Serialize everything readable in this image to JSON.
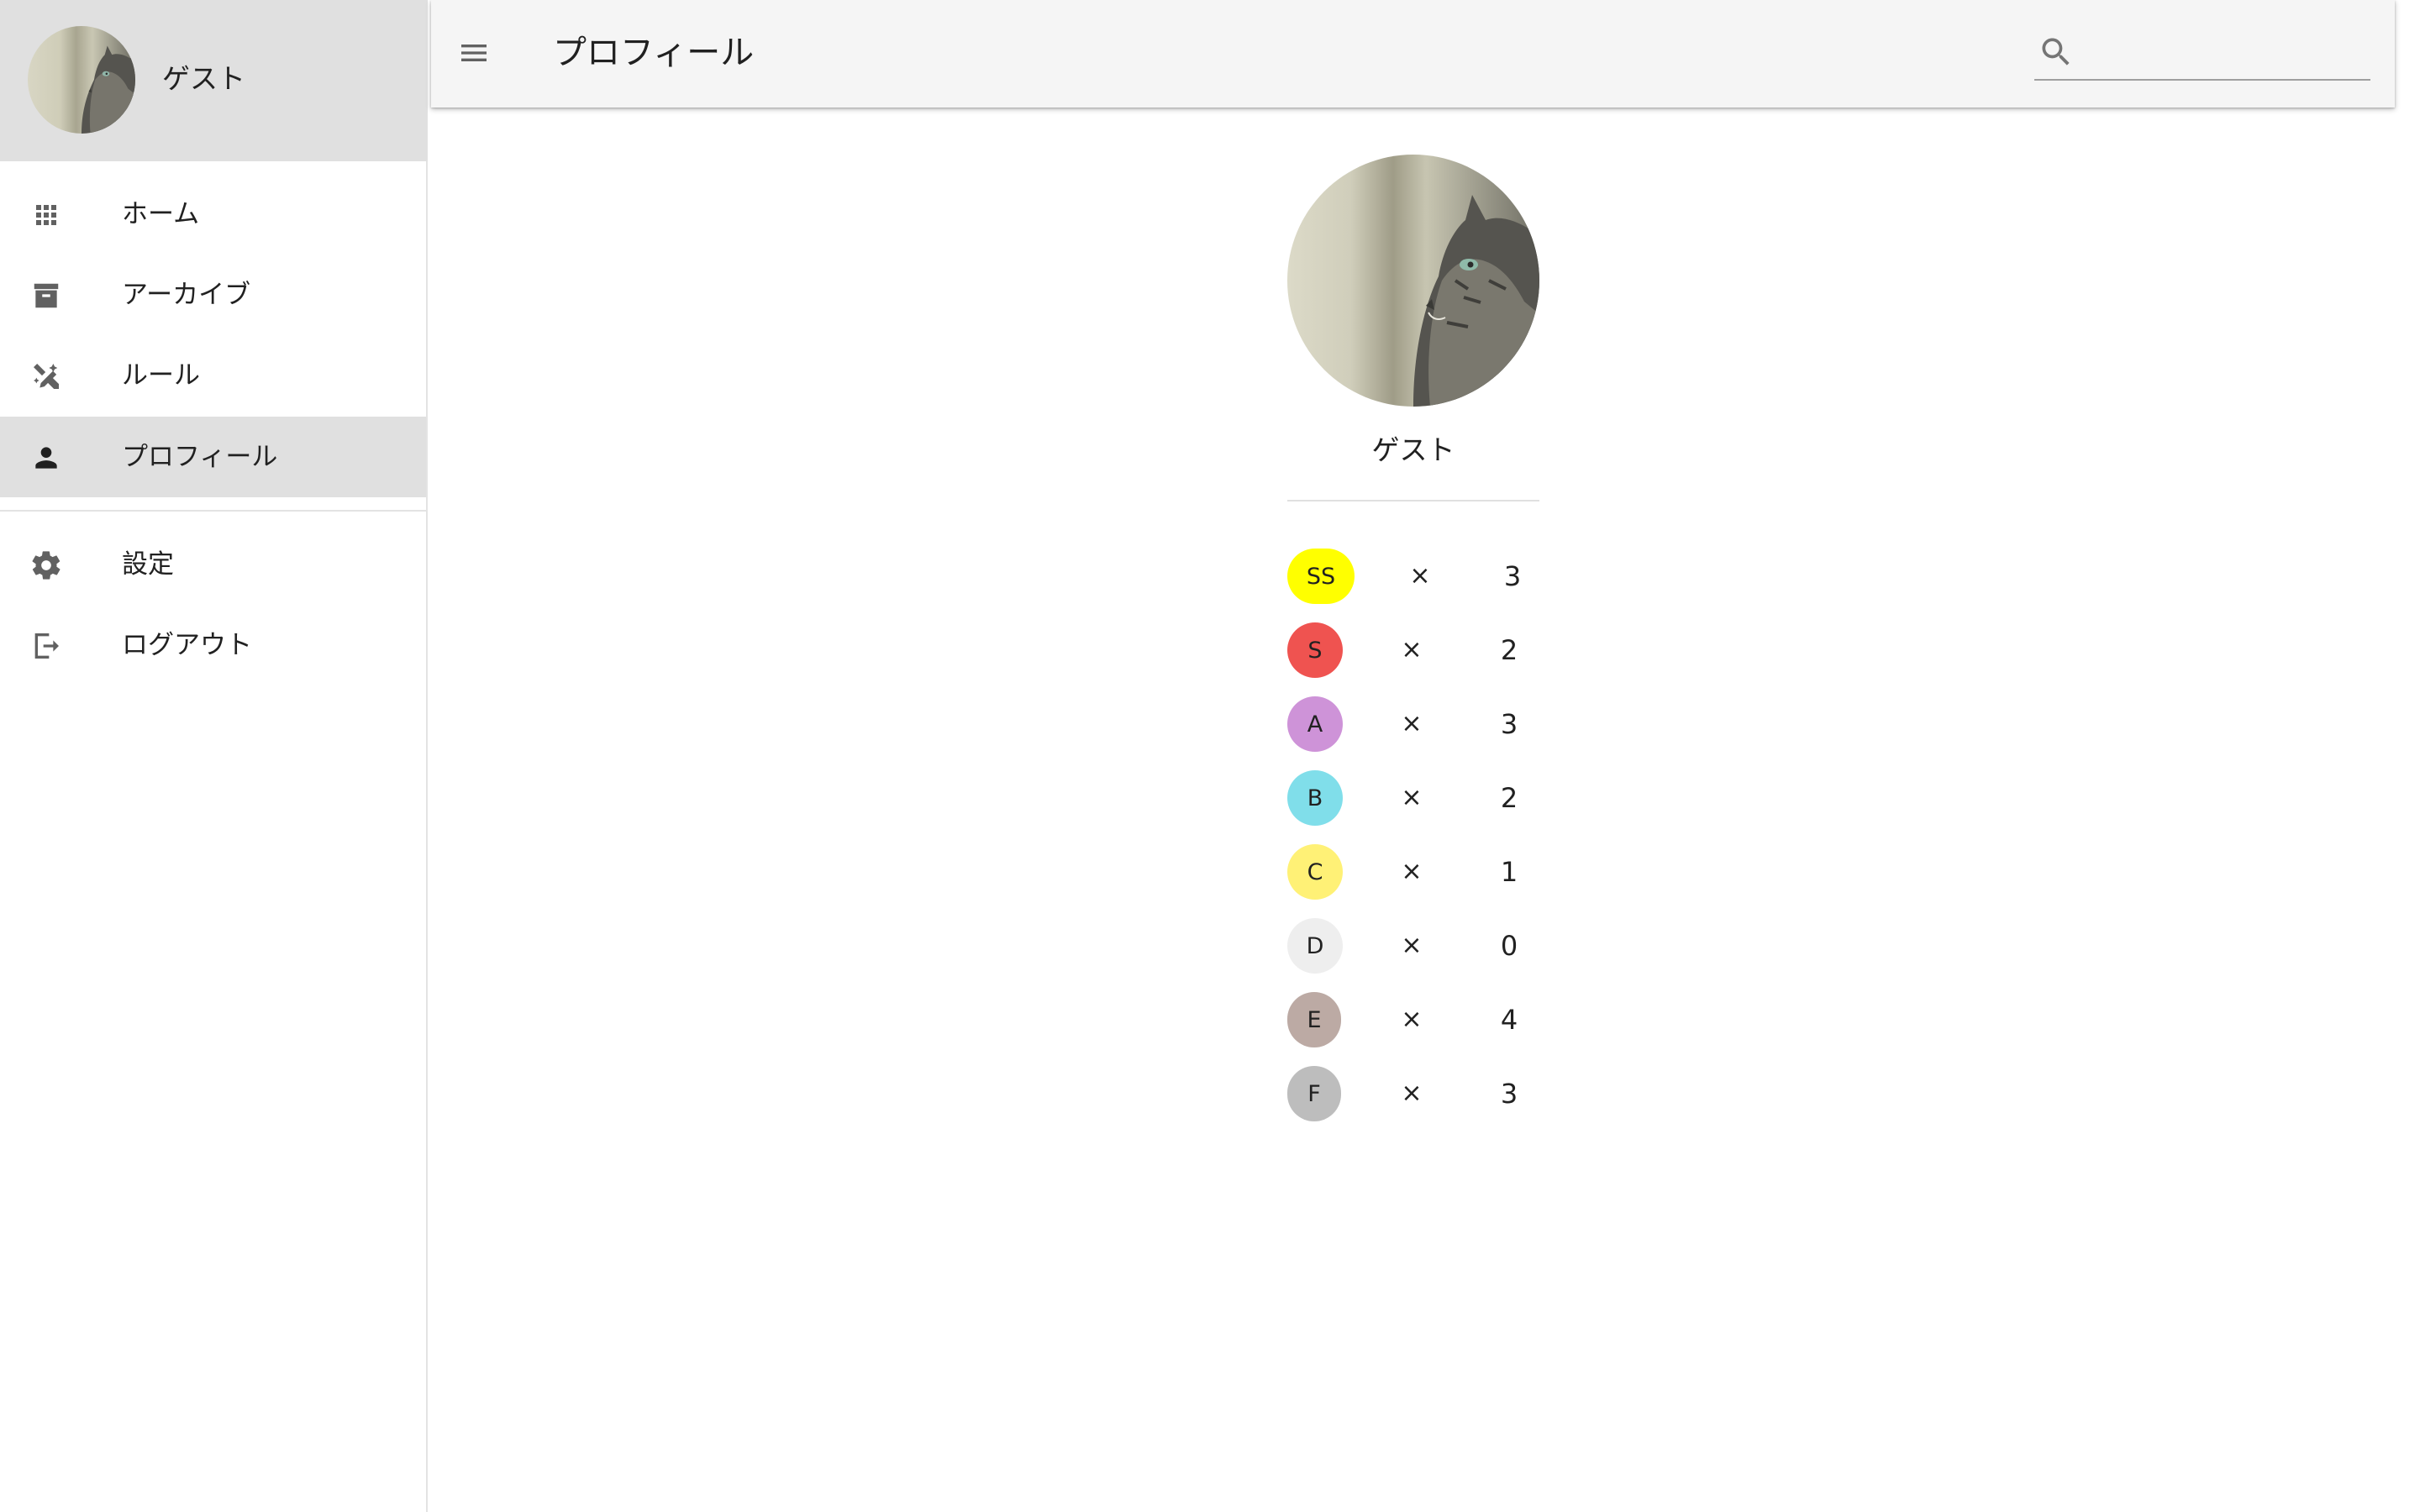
{
  "app": {
    "title": "プロフィール",
    "accent_active_bg": "#e0e0e0",
    "appbar_bg": "#f5f5f5"
  },
  "sidebar": {
    "user": {
      "name": "ゲスト",
      "avatar": "cat-photo"
    },
    "items": [
      {
        "label": "ホーム",
        "icon": "apps-grid-icon",
        "active": false
      },
      {
        "label": "アーカイブ",
        "icon": "archive-icon",
        "active": false
      },
      {
        "label": "ルール",
        "icon": "ruler-pencil-icon",
        "active": false
      },
      {
        "label": "プロフィール",
        "icon": "person-icon",
        "active": true
      },
      {
        "label": "設定",
        "icon": "gear-icon",
        "active": false
      },
      {
        "label": "ログアウト",
        "icon": "logout-icon",
        "active": false
      }
    ]
  },
  "appbar": {
    "menu_icon": "menu-icon",
    "search": {
      "placeholder": "",
      "value": "",
      "icon": "search-icon"
    }
  },
  "profile": {
    "name": "ゲスト",
    "photo": "cat-photo",
    "grades": [
      {
        "grade": "SS",
        "times": "×",
        "count": "3",
        "color": "#ffff00"
      },
      {
        "grade": "S",
        "times": "×",
        "count": "2",
        "color": "#ef5350"
      },
      {
        "grade": "A",
        "times": "×",
        "count": "3",
        "color": "#ce93d8"
      },
      {
        "grade": "B",
        "times": "×",
        "count": "2",
        "color": "#80deea"
      },
      {
        "grade": "C",
        "times": "×",
        "count": "1",
        "color": "#fff176"
      },
      {
        "grade": "D",
        "times": "×",
        "count": "0",
        "color": "#eeeeee"
      },
      {
        "grade": "E",
        "times": "×",
        "count": "4",
        "color": "#bcaaa4"
      },
      {
        "grade": "F",
        "times": "×",
        "count": "3",
        "color": "#bdbdbd"
      }
    ]
  }
}
